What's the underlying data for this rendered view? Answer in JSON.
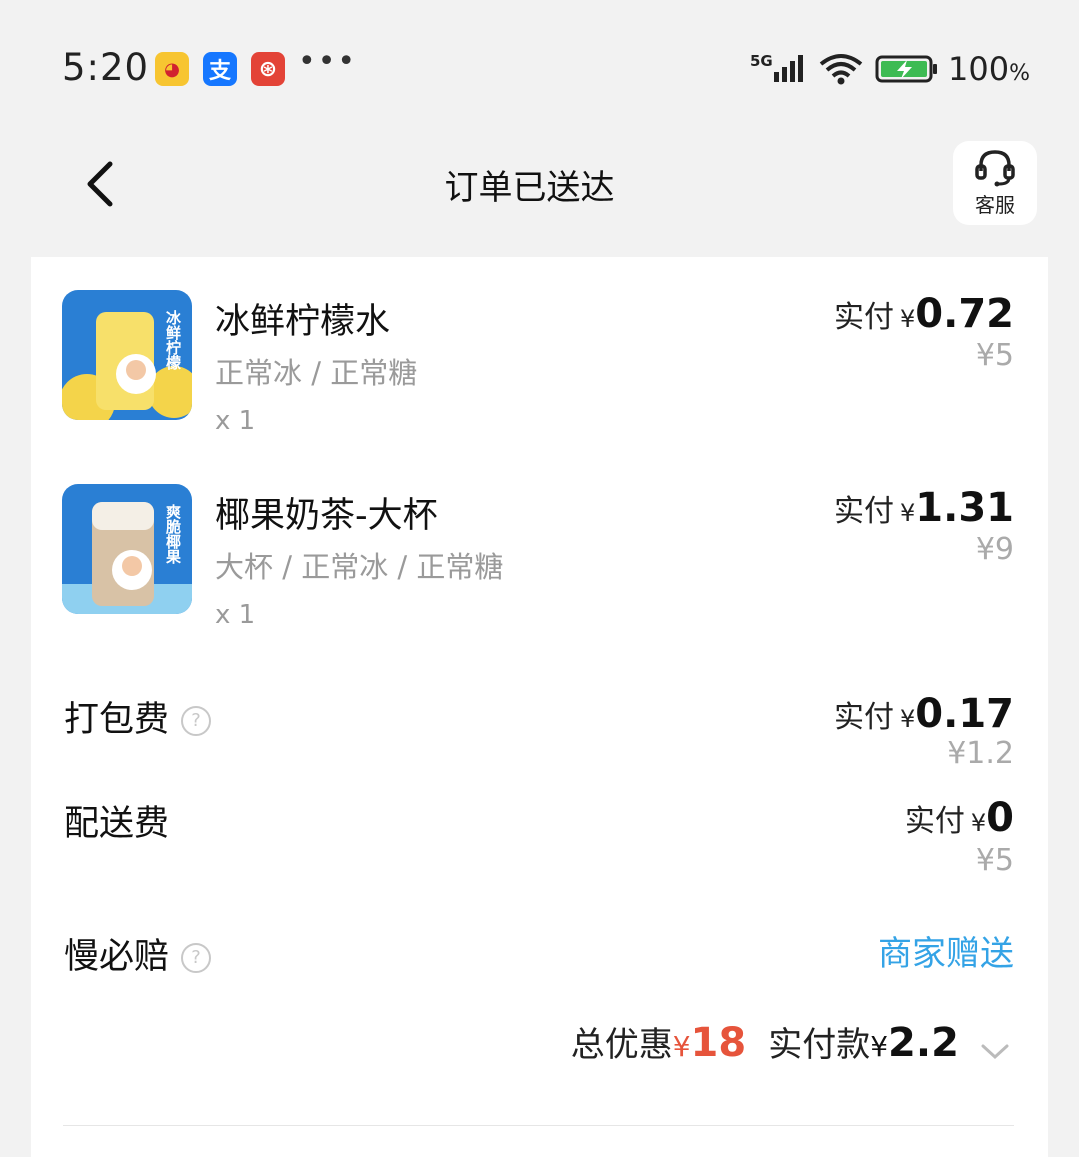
{
  "status_bar": {
    "time": "5:20",
    "net_label": "5G",
    "battery": "100",
    "battery_unit": "%",
    "icons": [
      "game-app-icon",
      "alipay-icon",
      "netease-music-icon",
      "more-dots-icon",
      "signal-icon",
      "wifi-icon",
      "battery-icon"
    ],
    "more": "•••",
    "alipay_glyph": "支",
    "netease_glyph": "⊛",
    "game_glyph": "◕"
  },
  "nav": {
    "title": "订单已送达",
    "service_label": "客服",
    "back_icon": "chevron-left-icon",
    "service_icon": "headset-icon"
  },
  "items": [
    {
      "name": "冰鲜柠檬水",
      "spec": "正常冰 / 正常糖",
      "qty": "x 1",
      "paid_label": "实付",
      "currency": "¥",
      "paid": "0.72",
      "original": "¥5",
      "thumb_text": "冰鲜柠檬",
      "thumb_colors": [
        "#2a7fd4",
        "#f4d44a"
      ]
    },
    {
      "name": "椰果奶茶-大杯",
      "spec": "大杯 / 正常冰 / 正常糖",
      "qty": "x 1",
      "paid_label": "实付",
      "currency": "¥",
      "paid": "1.31",
      "original": "¥9",
      "thumb_text": "爽脆椰果",
      "thumb_colors": [
        "#2a7fd4",
        "#d8c2a6"
      ]
    }
  ],
  "fees": {
    "packing": {
      "label": "打包费",
      "paid_label": "实付",
      "currency": "¥",
      "paid": "0.17",
      "original": "¥1.2"
    },
    "delivery": {
      "label": "配送费",
      "paid_label": "实付",
      "currency": "¥",
      "paid": "0",
      "original": "¥5"
    },
    "late_comp": {
      "label": "慢必赔",
      "value": "商家赠送"
    },
    "help_glyph": "?"
  },
  "summary": {
    "discount_label": "总优惠",
    "discount_currency": "¥",
    "discount_value": "18",
    "pay_label": "实付款",
    "pay_currency": "¥",
    "pay_value": "2.2"
  },
  "colors": {
    "accent_red": "#e6543b",
    "link_blue": "#34a3e6",
    "page_bg": "#f2f2f2"
  }
}
